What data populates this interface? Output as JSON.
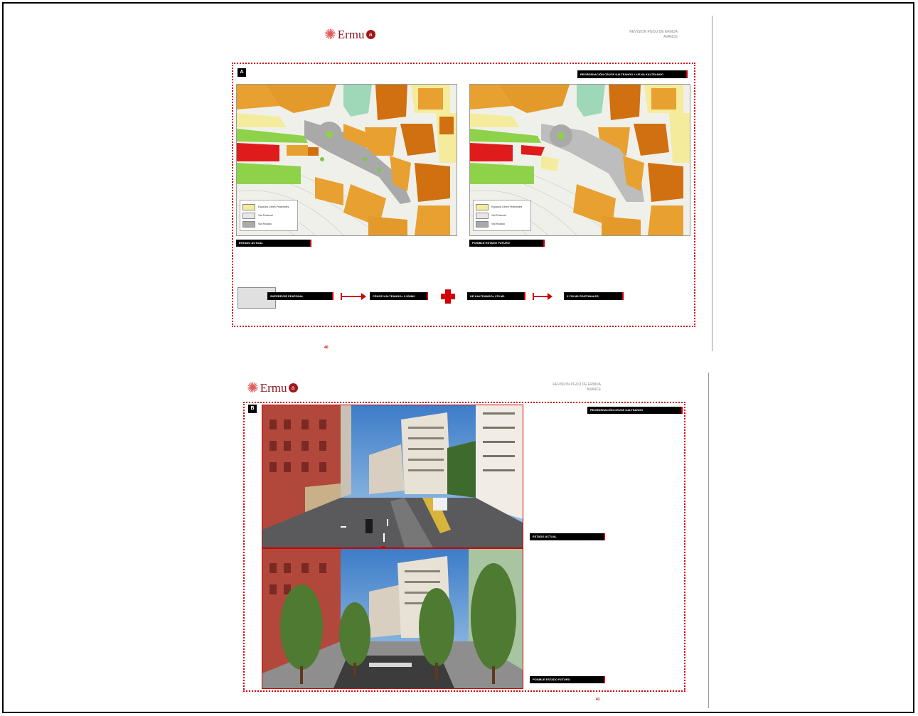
{
  "page1": {
    "logo_text": "Ermu",
    "logo_badge": "a",
    "header_line1": "REVISION PGOU DE ERMUA",
    "header_line2": "AVANCE",
    "section_number": "A",
    "title_bar": "REORDENACIÓN CRUCE KALTEANGO + UE-6A KALTEANGO",
    "caption_left": "ESTADO ACTUAL",
    "caption_right": "POSIBLE ESTADO FUTURO",
    "legend": [
      "Espacios Libres Peatonales",
      "Vial Peatonal",
      "Vial Rodado"
    ],
    "summary": {
      "label1": "SUPERFICIE PEATONAL",
      "label2": "CRUCE KALTEANGO= 2.300M2",
      "label3": "UE KALTEANGO= 370 M2",
      "label4": "2.720 M2 PEATONALES"
    },
    "page_number": "40"
  },
  "page2": {
    "logo_text": "Ermu",
    "logo_badge": "a",
    "header_line1": "REVISION PGOU DE ERMUA",
    "header_line2": "AVANCE",
    "section_number": "B",
    "title_bar": "REORDENACIÓN CRUCE KALTEANGO",
    "caption_top": "ESTADO ACTUAL",
    "caption_bottom": "POSIBLE ESTADO FUTURO",
    "page_number": "41"
  },
  "colors": {
    "accent_red": "#d20000",
    "map_orange": "#e8a030",
    "map_dark_orange": "#d07010",
    "map_yellow": "#f4ec9c",
    "map_green": "#8ed24a",
    "map_grey": "#bdbdbd"
  },
  "icons": {
    "arrow_right": "red-arrow-right-icon",
    "plus": "red-plus-icon",
    "arrow_down": "red-arrow-down-icon"
  }
}
